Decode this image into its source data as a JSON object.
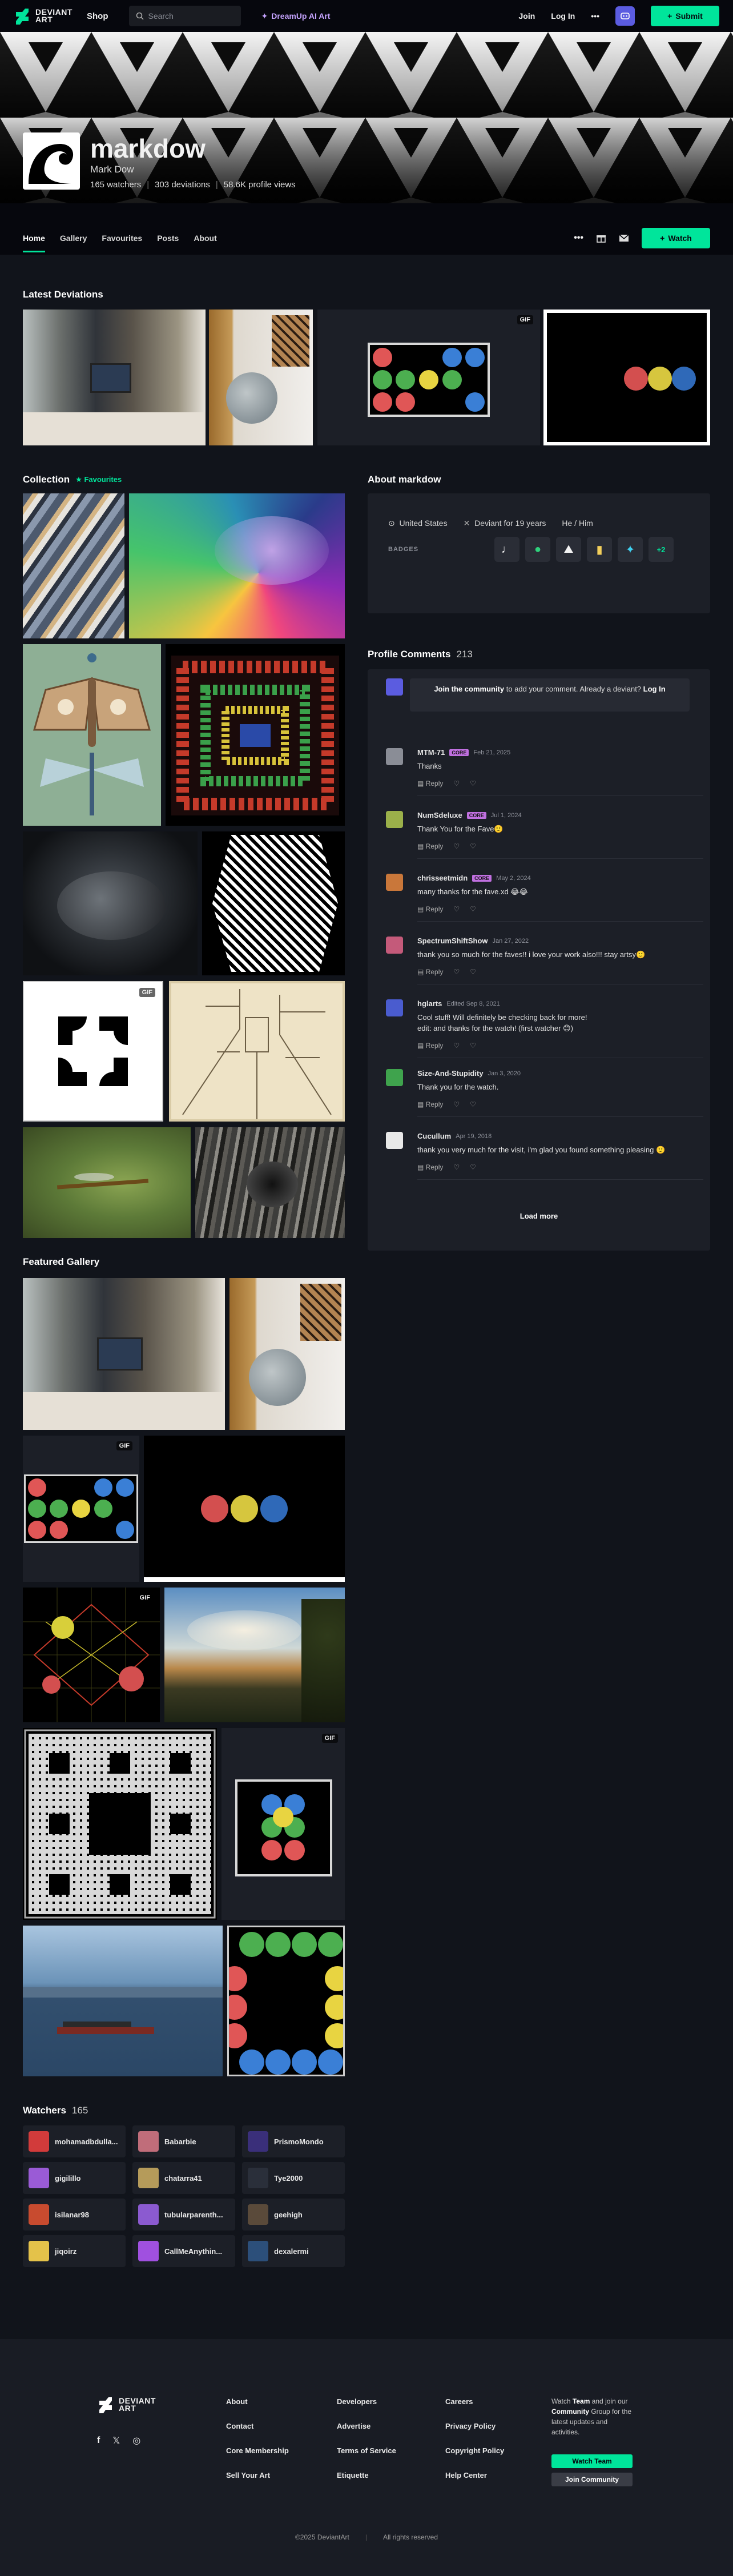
{
  "header": {
    "logo_text": "DEVIANT ART",
    "shop": "Shop",
    "search_placeholder": "Search",
    "dreamup": "DreamUp AI Art",
    "join": "Join",
    "login": "Log In",
    "more": "•••",
    "submit": "Submit"
  },
  "profile": {
    "username": "markdow",
    "realname": "Mark Dow",
    "watchers": "165 watchers",
    "deviations": "303 deviations",
    "pageviews": "58.6K profile views"
  },
  "tabs": [
    "Home",
    "Gallery",
    "Favourites",
    "Posts",
    "About"
  ],
  "watch_label": "Watch",
  "latest": {
    "title": "Latest Deviations",
    "gif": "GIF"
  },
  "collection": {
    "title": "Collection",
    "sub": "Favourites"
  },
  "about": {
    "title": "About markdow",
    "location": "United States",
    "deviant": "Deviant for 19 years",
    "pronouns": "He / Him",
    "badges_label": "BADGES",
    "more_badges": "+2"
  },
  "comments": {
    "title": "Profile Comments",
    "count": "213",
    "join_text": "Join the community",
    "join_rest": " to add your comment. Already a deviant? ",
    "login": "Log In",
    "reply": "Reply",
    "load_more": "Load more",
    "items": [
      {
        "user": "MTM-71",
        "tag": "CORE",
        "date": "Feb 21, 2025",
        "text": [
          "Thanks"
        ]
      },
      {
        "user": "NumSdeluxe",
        "tag": "CORE",
        "date": "Jul 1, 2024",
        "text": [
          "Thank You for the Fave🙂"
        ]
      },
      {
        "user": "chrisseetmidn",
        "tag": "CORE",
        "date": "May 2, 2024",
        "text": [
          "many thanks for the fave.xd 😂😂"
        ]
      },
      {
        "user": "SpectrumShiftShow",
        "tag": "",
        "date": "Jan 27, 2022",
        "text": [
          "thank you so much for the faves!! i love your work also!!! stay artsy🙂"
        ]
      },
      {
        "user": "hglarts",
        "tag": "",
        "date": "Edited Sep 8, 2021",
        "text": [
          "Cool stuff! Will definitely be checking back for more!",
          "edit: and thanks for the watch! (first watcher 😊)"
        ]
      },
      {
        "user": "Size-And-Stupidity",
        "tag": "",
        "date": "Jan 3, 2020",
        "text": [
          "Thank you for the watch."
        ]
      },
      {
        "user": "Cucullum",
        "tag": "",
        "date": "Apr 19, 2018",
        "text": [
          "thank you very much for the visit, i'm glad you found something pleasing 🙂"
        ]
      }
    ]
  },
  "featured": {
    "title": "Featured Gallery",
    "gif": "GIF"
  },
  "watchers": {
    "title": "Watchers",
    "count": "165",
    "items": [
      "mohamadbdulla...",
      "Babarbie",
      "PrismoMondo",
      "gigilillo",
      "chatarra41",
      "Tye2000",
      "isilanar98",
      "tubularparenth...",
      "geehigh",
      "jiqoirz",
      "CallMeAnythin...",
      "dexalermi"
    ]
  },
  "footer": {
    "col1": [
      "About",
      "Contact",
      "Core Membership",
      "Sell Your Art"
    ],
    "col2": [
      "Developers",
      "Advertise",
      "Terms of Service",
      "Etiquette"
    ],
    "col3": [
      "Careers",
      "Privacy Policy",
      "Copyright Policy",
      "Help Center"
    ],
    "team_text1": "Watch ",
    "team_name": "Team",
    "team_text2": " and join our ",
    "community": "Community",
    "team_text3": " Group for the latest updates and activities.",
    "watch_team": "Watch Team",
    "join_community": "Join Community",
    "copyright": "©2025 DeviantArt",
    "rights": "All rights reserved"
  },
  "colors": {
    "accent": "#00e59b",
    "bg": "#06070d",
    "panel": "#1c1f27"
  }
}
